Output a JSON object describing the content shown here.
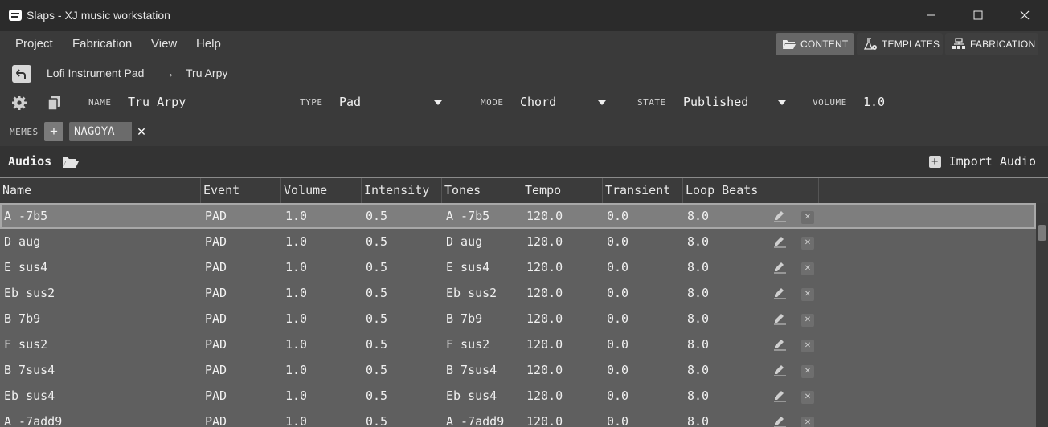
{
  "window": {
    "title": "Slaps - XJ music workstation",
    "controls": [
      "minimize-icon",
      "maximize-icon",
      "close-icon"
    ]
  },
  "menu": {
    "items": [
      "Project",
      "Fabrication",
      "View",
      "Help"
    ]
  },
  "nav": {
    "content": "CONTENT",
    "templates": "TEMPLATES",
    "fabrication": "FABRICATION"
  },
  "breadcrumb": {
    "parent": "Lofi Instrument Pad",
    "arrow": "→",
    "current": "Tru Arpy"
  },
  "instrument": {
    "name_label": "NAME",
    "name": "Tru Arpy",
    "type_label": "TYPE",
    "type": "Pad",
    "mode_label": "MODE",
    "mode": "Chord",
    "state_label": "STATE",
    "state": "Published",
    "volume_label": "VOLUME",
    "volume": "1.0",
    "memes_label": "MEMES",
    "add_meme": "+",
    "memes": [
      "NAGOYA"
    ]
  },
  "audios": {
    "title": "Audios",
    "import_label": "Import Audio",
    "columns": [
      "Name",
      "Event",
      "Volume",
      "Intensity",
      "Tones",
      "Tempo",
      "Transient",
      "Loop Beats"
    ],
    "rows": [
      [
        "A -7b5",
        "PAD",
        "1.0",
        "0.5",
        "A -7b5",
        "120.0",
        "0.0",
        "8.0"
      ],
      [
        "D aug",
        "PAD",
        "1.0",
        "0.5",
        "D aug",
        "120.0",
        "0.0",
        "8.0"
      ],
      [
        "E sus4",
        "PAD",
        "1.0",
        "0.5",
        "E sus4",
        "120.0",
        "0.0",
        "8.0"
      ],
      [
        "Eb sus2",
        "PAD",
        "1.0",
        "0.5",
        "Eb sus2",
        "120.0",
        "0.0",
        "8.0"
      ],
      [
        "B 7b9",
        "PAD",
        "1.0",
        "0.5",
        "B 7b9",
        "120.0",
        "0.0",
        "8.0"
      ],
      [
        "F sus2",
        "PAD",
        "1.0",
        "0.5",
        "F sus2",
        "120.0",
        "0.0",
        "8.0"
      ],
      [
        "B 7sus4",
        "PAD",
        "1.0",
        "0.5",
        "B 7sus4",
        "120.0",
        "0.0",
        "8.0"
      ],
      [
        "Eb sus4",
        "PAD",
        "1.0",
        "0.5",
        "Eb sus4",
        "120.0",
        "0.0",
        "8.0"
      ],
      [
        "A -7add9",
        "PAD",
        "1.0",
        "0.5",
        "A -7add9",
        "120.0",
        "0.0",
        "8.0"
      ]
    ],
    "selected_row": 0
  }
}
